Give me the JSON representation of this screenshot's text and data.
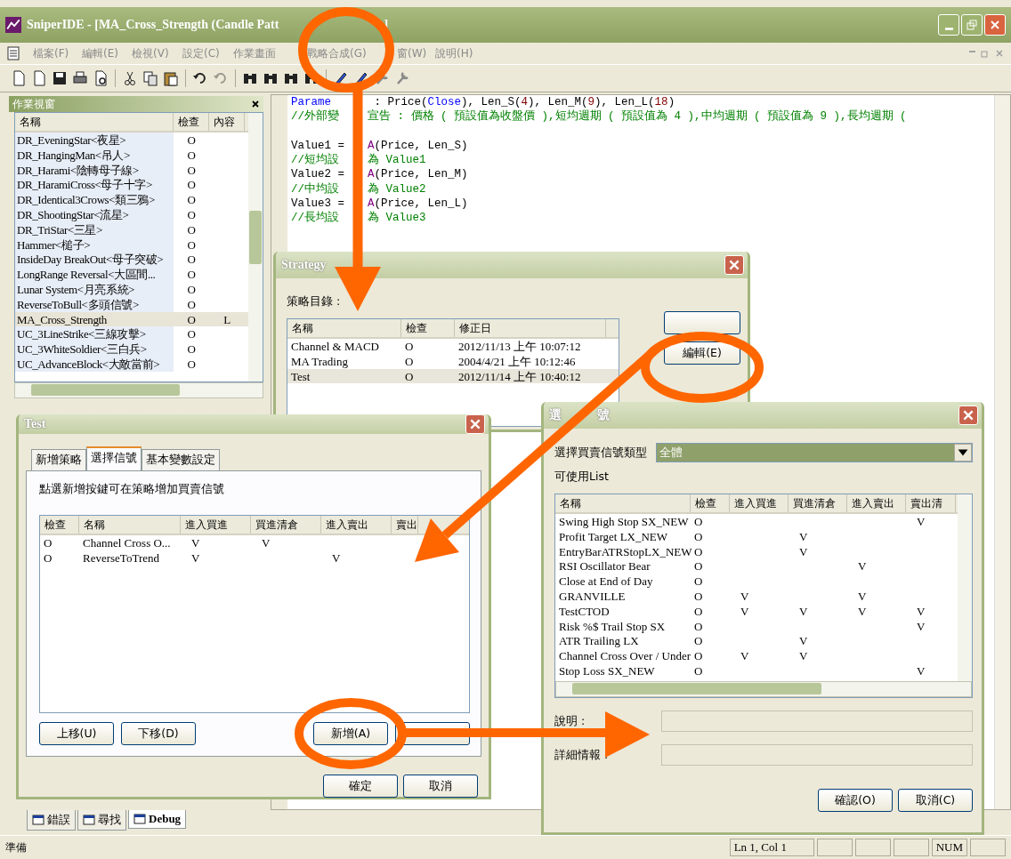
{
  "window": {
    "title": "SniperIDE - [MA_Cross_Strength (Candle Patt",
    "title_end": "]"
  },
  "menu": [
    "檔案(F)",
    "編輯(E)",
    "檢視(V)",
    "設定(C)",
    "作業畫面",
    "戰略合成(G)",
    "窗(W)",
    "說明(H)"
  ],
  "work_panel": {
    "title": "作業視窗",
    "columns": [
      "名稱",
      "檢查",
      "內容"
    ],
    "rows": [
      {
        "name": "DR_EveningStar<夜星>",
        "check": "O",
        "content": null,
        "selected": false
      },
      {
        "name": "DR_HangingMan<吊人>",
        "check": "O",
        "content": null,
        "selected": false
      },
      {
        "name": "DR_Harami<陰轉母子線>",
        "check": "O",
        "content": null,
        "selected": false
      },
      {
        "name": "DR_HaramiCross<母子十字>",
        "check": "O",
        "content": null,
        "selected": false
      },
      {
        "name": "DR_Identical3Crows<類三鴉>",
        "check": "O",
        "content": null,
        "selected": false
      },
      {
        "name": "DR_ShootingStar<流星>",
        "check": "O",
        "content": null,
        "selected": false
      },
      {
        "name": "DR_TriStar<三星>",
        "check": "O",
        "content": null,
        "selected": false
      },
      {
        "name": "Hammer<槌子>",
        "check": "O",
        "content": null,
        "selected": false
      },
      {
        "name": "InsideDay BreakOut<母子突破>",
        "check": "O",
        "content": null,
        "selected": false
      },
      {
        "name": "LongRange Reversal<大區間...",
        "check": "O",
        "content": null,
        "selected": false
      },
      {
        "name": "Lunar System<月亮系統>",
        "check": "O",
        "content": null,
        "selected": false
      },
      {
        "name": "ReverseToBull<多頭信號>",
        "check": "O",
        "content": null,
        "selected": false
      },
      {
        "name": "MA_Cross_Strength",
        "check": "O",
        "content": "L",
        "selected": true
      },
      {
        "name": "UC_3LineStrike<三線攻擊>",
        "check": "O",
        "content": null,
        "selected": false
      },
      {
        "name": "UC_3WhiteSoldier<三白兵>",
        "check": "O",
        "content": null,
        "selected": false
      },
      {
        "name": "UC_AdvanceBlock<大敵當前>",
        "check": "O",
        "content": null,
        "selected": false
      }
    ]
  },
  "editor": {
    "paragraphs": [
      [
        {
          "segments": [
            {
              "text": "Parame",
              "kind": "keyword"
            },
            {
              "kind": "covered"
            },
            {
              "text": " : Price(",
              "kind": "plain"
            },
            {
              "text": "Close",
              "kind": "keyword"
            },
            {
              "text": "), Len_S(",
              "kind": "plain"
            },
            {
              "text": "4",
              "kind": "number"
            },
            {
              "text": "), Len_M(",
              "kind": "plain"
            },
            {
              "text": "9",
              "kind": "number"
            },
            {
              "text": "), Len_L(",
              "kind": "plain"
            },
            {
              "text": "18",
              "kind": "number"
            },
            {
              "text": ")",
              "kind": "plain"
            }
          ]
        },
        {
          "segments": [
            {
              "text": "//外部變",
              "kind": "comment"
            },
            {
              "kind": "covered"
            },
            {
              "text": "宣告 : 價格 ( 預設值為收盤價 ),短均週期 ( 預設值為 4 ),中均週期 ( 預設值為 9 ),長均週期 (",
              "kind": "comment"
            }
          ]
        }
      ],
      [
        {
          "segments": [
            {
              "text": "Value1 = ",
              "kind": "plain"
            },
            {
              "kind": "covered"
            },
            {
              "text": "A",
              "kind": "function"
            },
            {
              "text": "(Price, Len_S)",
              "kind": "plain"
            }
          ]
        },
        {
          "segments": [
            {
              "text": "//短均設",
              "kind": "comment"
            },
            {
              "kind": "covered"
            },
            {
              "text": "為 Value1",
              "kind": "comment"
            }
          ]
        },
        {
          "segments": [
            {
              "text": "Value2 = ",
              "kind": "plain"
            },
            {
              "kind": "covered"
            },
            {
              "text": "A",
              "kind": "function"
            },
            {
              "text": "(Price, Len_M)",
              "kind": "plain"
            }
          ]
        },
        {
          "segments": [
            {
              "text": "//中均設",
              "kind": "comment"
            },
            {
              "kind": "covered"
            },
            {
              "text": "為 Value2",
              "kind": "comment"
            }
          ]
        },
        {
          "segments": [
            {
              "text": "Value3 = ",
              "kind": "plain"
            },
            {
              "kind": "covered"
            },
            {
              "text": "A",
              "kind": "function"
            },
            {
              "text": "(Price, Len_L)",
              "kind": "plain"
            }
          ]
        },
        {
          "segments": [
            {
              "text": "//長均設",
              "kind": "comment"
            },
            {
              "kind": "covered"
            },
            {
              "text": "為 Value3",
              "kind": "comment"
            }
          ]
        }
      ]
    ]
  },
  "strategy_dialog": {
    "title": "Strategy",
    "label": "策略目錄 :",
    "columns": [
      "名稱",
      "檢查",
      "修正日"
    ],
    "rows": [
      {
        "cells": [
          "Channel & MACD",
          "O",
          "2012/11/13 上午 10:07:12"
        ],
        "selected": false
      },
      {
        "cells": [
          "MA Trading",
          "O",
          "2004/4/21 上午 10:12:46"
        ],
        "selected": false
      },
      {
        "cells": [
          "Test",
          "O",
          "2012/11/14 上午 10:40:12"
        ],
        "selected": true
      }
    ],
    "buttons": [
      "編輯(E)"
    ]
  },
  "test_dialog": {
    "title": "Test",
    "tabs": [
      {
        "label": "新增策略",
        "selected": false
      },
      {
        "label": "選擇信號",
        "selected": true
      },
      {
        "label": "基本變數設定",
        "selected": false
      }
    ],
    "hint": "點選新增按鍵可在策略增加買賣信號",
    "columns": [
      "檢查",
      "名稱",
      "進入買進",
      "買進清倉",
      "進入賣出",
      "賣出"
    ],
    "rows": [
      {
        "cells": [
          "O",
          "Channel Cross O...",
          "V",
          "V",
          null,
          null
        ],
        "selected": false
      },
      {
        "cells": [
          "O",
          "ReverseToTrend",
          "V",
          null,
          "V",
          null
        ],
        "selected": false
      }
    ],
    "left_buttons": [
      "上移(U)",
      "下移(D)"
    ],
    "right_buttons": [
      "新增(A)"
    ],
    "footer_buttons": [
      "確定",
      "取消"
    ]
  },
  "signal_dialog": {
    "title_parts": [
      "選",
      "號"
    ],
    "type_label": "選擇買賣信號類型",
    "type_value": "全體",
    "list_label": "可使用List",
    "columns": [
      "名稱",
      "檢查",
      "進入買進",
      "買進清倉",
      "進入賣出",
      "賣出清"
    ],
    "rows": [
      {
        "cells": [
          "Swing High Stop SX_NEW",
          "O",
          null,
          null,
          null,
          "V"
        ],
        "selected": false
      },
      {
        "cells": [
          "Profit Target LX_NEW",
          "O",
          null,
          "V",
          null,
          null
        ],
        "selected": false
      },
      {
        "cells": [
          "EntryBarATRStopLX_NEW",
          "O",
          null,
          "V",
          null,
          null
        ],
        "selected": false
      },
      {
        "cells": [
          "RSI Oscillator Bear",
          "O",
          null,
          null,
          "V",
          null
        ],
        "selected": false
      },
      {
        "cells": [
          "Close at End of Day",
          "O",
          null,
          null,
          null,
          null
        ],
        "selected": false
      },
      {
        "cells": [
          "GRANVILLE",
          "O",
          "V",
          null,
          "V",
          null
        ],
        "selected": false
      },
      {
        "cells": [
          "TestCTOD",
          "O",
          "V",
          "V",
          "V",
          "V"
        ],
        "selected": false
      },
      {
        "cells": [
          "Risk %$ Trail Stop SX",
          "O",
          null,
          null,
          null,
          "V"
        ],
        "selected": false
      },
      {
        "cells": [
          "ATR Trailing LX",
          "O",
          null,
          "V",
          null,
          null
        ],
        "selected": false
      },
      {
        "cells": [
          "Channel Cross Over / Under",
          "O",
          "V",
          "V",
          null,
          null
        ],
        "selected": false
      },
      {
        "cells": [
          "Stop Loss SX_NEW",
          "O",
          null,
          null,
          null,
          "V"
        ],
        "selected": false
      }
    ],
    "desc_label": "說明 :",
    "detail_label": "詳細情報 :",
    "buttons": [
      "確認(O)",
      "取消(C)"
    ]
  },
  "bottom_tabs": [
    {
      "label": "錯誤",
      "selected": false
    },
    {
      "label": "尋找",
      "selected": false
    },
    {
      "label": "Debug",
      "selected": true
    }
  ],
  "status_bar": {
    "text": "準備",
    "cells": [
      "Ln 1, Col 1",
      null,
      null,
      null,
      "NUM",
      null
    ]
  }
}
